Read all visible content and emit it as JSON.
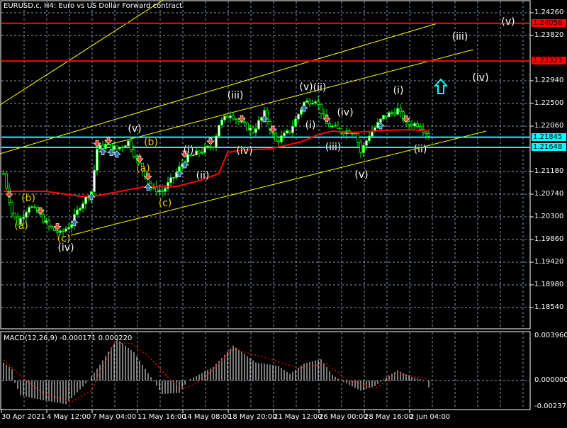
{
  "header": {
    "title": "EURUSD.c, H4:  Euro vs US Dollar Forward contract"
  },
  "macd": {
    "title": "MACD(12,26,9) -0.000171 0.000220",
    "scale": [
      "0.003960",
      "0.000000",
      "-0.002375"
    ]
  },
  "price_scale": [
    "1.24260",
    "1.23820",
    "1.22940",
    "1.22500",
    "1.22060",
    "1.21180",
    "1.20740",
    "1.20300",
    "1.19860",
    "1.19420",
    "1.18980",
    "1.18540"
  ],
  "price_levels": [
    {
      "label": "1.24056",
      "value": 1.24056,
      "color": "#ff0000",
      "kind": "red"
    },
    {
      "label": "1.23323",
      "value": 1.23323,
      "color": "#ff0000",
      "kind": "red"
    },
    {
      "label": "1.21845",
      "value": 1.21845,
      "color": "#00ffff",
      "kind": "cyan"
    },
    {
      "label": "1.21648",
      "value": 1.21648,
      "color": "#00ffff",
      "kind": "cyan"
    }
  ],
  "time_axis": [
    "30 Apr 2021",
    "4 May 12:00",
    "7 May 04:00",
    "11 May 16:00",
    "14 May 08:00",
    "18 May 20:00",
    "21 May 12:00",
    "26 May 00:00",
    "28 May 16:00",
    "2 Jun 04:00"
  ],
  "wave_labels": [
    "(v)",
    "(i)",
    "(ii)",
    "(iii)",
    "(iv)",
    "(v)",
    "(ii)",
    "(i)",
    "(iv)",
    "(iii)",
    "(v)",
    "(i)",
    "(ii)",
    "(iv)",
    "(v)",
    "(iii)",
    "(iv)",
    "(a)",
    "(b)",
    "(c)",
    "(b)",
    "(a)",
    "(c)"
  ],
  "colors": {
    "candle": "#00ff00",
    "ma": "#ff0000",
    "channel": "#ffff00",
    "grid": "#8899aa",
    "buy_arrow": "#1e6eb4",
    "sell_arrow": "#e8452c",
    "signal_arrow": "#00ffff"
  },
  "chart_data": {
    "type": "candlestick",
    "symbol": "EURUSD.c",
    "timeframe": "H4",
    "ylim": [
      1.181,
      1.246
    ],
    "close_keypoints": [
      [
        0,
        1.21139
      ],
      [
        3,
        1.20382
      ],
      [
        5,
        1.20176
      ],
      [
        9,
        1.2052
      ],
      [
        12,
        1.20382
      ],
      [
        16,
        1.20107
      ],
      [
        20,
        1.1997
      ],
      [
        24,
        1.20176
      ],
      [
        27,
        1.2052
      ],
      [
        31,
        1.20795
      ],
      [
        33,
        1.2162
      ],
      [
        36,
        1.21689
      ],
      [
        40,
        1.2162
      ],
      [
        44,
        1.21757
      ],
      [
        49,
        1.21207
      ],
      [
        52,
        1.20864
      ],
      [
        56,
        1.20795
      ],
      [
        60,
        1.2107
      ],
      [
        64,
        1.21414
      ],
      [
        69,
        1.21551
      ],
      [
        74,
        1.21689
      ],
      [
        76,
        1.22101
      ],
      [
        80,
        1.22307
      ],
      [
        84,
        1.22101
      ],
      [
        88,
        1.21964
      ],
      [
        92,
        1.22307
      ],
      [
        96,
        1.21757
      ],
      [
        101,
        1.21964
      ],
      [
        106,
        1.22514
      ],
      [
        110,
        1.22582
      ],
      [
        114,
        1.22101
      ],
      [
        119,
        1.21964
      ],
      [
        124,
        1.21964
      ],
      [
        126,
        1.21551
      ],
      [
        129,
        1.21895
      ],
      [
        134,
        1.22239
      ],
      [
        139,
        1.22376
      ],
      [
        142,
        1.22101
      ],
      [
        146,
        1.22101
      ],
      [
        150,
        1.21895
      ]
    ],
    "ma_keypoints": [
      [
        0,
        1.20795
      ],
      [
        15,
        1.20795
      ],
      [
        27,
        1.20699
      ],
      [
        32,
        1.20699
      ],
      [
        49,
        1.20877
      ],
      [
        61,
        1.2089
      ],
      [
        69,
        1.21001
      ],
      [
        76,
        1.21139
      ],
      [
        79,
        1.21551
      ],
      [
        84,
        1.21592
      ],
      [
        94,
        1.2162
      ],
      [
        105,
        1.21757
      ],
      [
        111,
        1.21895
      ],
      [
        116,
        1.21964
      ],
      [
        124,
        1.21936
      ],
      [
        134,
        1.21977
      ],
      [
        144,
        1.21991
      ],
      [
        150,
        1.21964
      ]
    ],
    "macd_hist_keypoints": [
      [
        0,
        0.0016
      ],
      [
        3,
        0.001
      ],
      [
        4,
        -0.0002
      ],
      [
        6,
        -0.0013
      ],
      [
        11,
        -0.0016
      ],
      [
        22,
        -0.0021
      ],
      [
        30,
        0
      ],
      [
        34,
        0.0014
      ],
      [
        40,
        0.0037
      ],
      [
        46,
        0.0025
      ],
      [
        52,
        0.0003
      ],
      [
        56,
        -0.0012
      ],
      [
        62,
        -0.0011
      ],
      [
        65,
        0
      ],
      [
        74,
        0.0012
      ],
      [
        81,
        0.0031
      ],
      [
        89,
        0.0016
      ],
      [
        97,
        0.0013
      ],
      [
        101,
        0.0006
      ],
      [
        106,
        0.0015
      ],
      [
        112,
        0.0019
      ],
      [
        116,
        0.0005
      ],
      [
        119,
        0
      ],
      [
        126,
        -0.0009
      ],
      [
        131,
        -0.0005
      ],
      [
        135,
        0.0003
      ],
      [
        139,
        0.0009
      ],
      [
        144,
        0.0003
      ],
      [
        149,
        0
      ],
      [
        150,
        -0.0006
      ]
    ],
    "macd_signal_keypoints": [
      [
        0,
        0.0018
      ],
      [
        8,
        0
      ],
      [
        14,
        -0.0011
      ],
      [
        24,
        -0.0019
      ],
      [
        31,
        -0.0009
      ],
      [
        39,
        0.0033
      ],
      [
        45,
        0.0033
      ],
      [
        51,
        0.0022
      ],
      [
        59,
        0
      ],
      [
        64,
        -0.0007
      ],
      [
        70,
        0
      ],
      [
        81,
        0.0028
      ],
      [
        94,
        0.0019
      ],
      [
        104,
        0.0011
      ],
      [
        114,
        0.0015
      ],
      [
        121,
        0.0001
      ],
      [
        131,
        -0.0007
      ],
      [
        139,
        0.0006
      ],
      [
        149,
        0.0002
      ]
    ],
    "macd_ylim": [
      -0.002375,
      0.00396
    ],
    "arrows": [
      [
        2,
        "sell"
      ],
      [
        13,
        "sell"
      ],
      [
        19,
        "sell"
      ],
      [
        25,
        "buy"
      ],
      [
        31,
        "buy"
      ],
      [
        33,
        "sell"
      ],
      [
        35,
        "buy"
      ],
      [
        37,
        "sell"
      ],
      [
        38,
        "buy"
      ],
      [
        40,
        "buy"
      ],
      [
        48,
        "sell"
      ],
      [
        51,
        "sell"
      ],
      [
        51,
        "buy"
      ],
      [
        62,
        "buy"
      ],
      [
        64,
        "sell"
      ],
      [
        64,
        "buy"
      ],
      [
        73,
        "sell"
      ],
      [
        84,
        "sell"
      ],
      [
        92,
        "buy"
      ],
      [
        95,
        "sell"
      ],
      [
        106,
        "buy"
      ],
      [
        114,
        "sell"
      ],
      [
        133,
        "buy"
      ],
      [
        142,
        "sell"
      ]
    ]
  }
}
